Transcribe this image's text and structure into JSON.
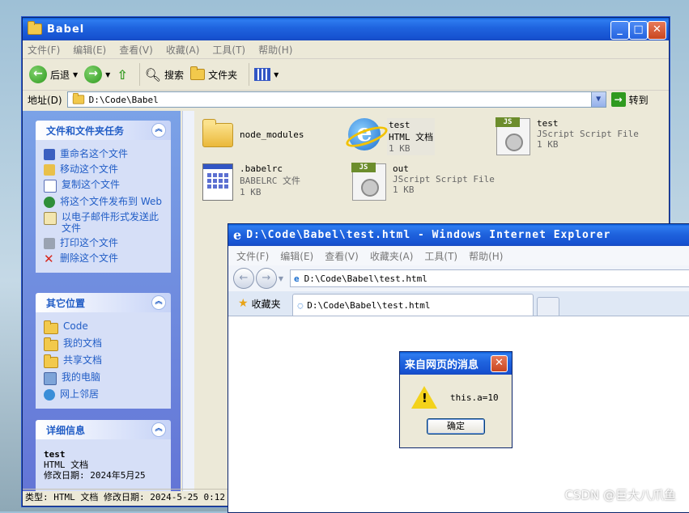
{
  "explorer": {
    "title": "Babel",
    "menu": [
      "文件(F)",
      "编辑(E)",
      "查看(V)",
      "收藏(A)",
      "工具(T)",
      "帮助(H)"
    ],
    "toolbar": {
      "back": "后退",
      "search": "搜索",
      "folders": "文件夹"
    },
    "address_label": "地址(D)",
    "address_value": "D:\\Code\\Babel",
    "go": "转到",
    "tasks_panel": {
      "title": "文件和文件夹任务",
      "items": [
        "重命名这个文件",
        "移动这个文件",
        "复制这个文件",
        "将这个文件发布到 Web",
        "以电子邮件形式发送此文件",
        "打印这个文件",
        "删除这个文件"
      ]
    },
    "places_panel": {
      "title": "其它位置",
      "items": [
        "Code",
        "我的文档",
        "共享文档",
        "我的电脑",
        "网上邻居"
      ]
    },
    "details_panel": {
      "title": "详细信息",
      "name": "test",
      "type": "HTML 文档",
      "modified": "修改日期: 2024年5月25"
    },
    "files": [
      {
        "name": "node_modules",
        "type": "",
        "size": ""
      },
      {
        "name": "test",
        "type": "HTML 文档",
        "size": "1 KB"
      },
      {
        "name": "test",
        "type": "JScript Script File",
        "size": "1 KB"
      },
      {
        "name": ".babelrc",
        "type": "BABELRC 文件",
        "size": "1 KB"
      },
      {
        "name": "out",
        "type": "JScript Script File",
        "size": "1 KB"
      }
    ],
    "status": "类型: HTML 文档 修改日期: 2024-5-25 0:12"
  },
  "ie": {
    "title": "D:\\Code\\Babel\\test.html - Windows Internet Explorer",
    "menu": [
      "文件(F)",
      "编辑(E)",
      "查看(V)",
      "收藏夹(A)",
      "工具(T)",
      "帮助(H)"
    ],
    "address": "D:\\Code\\Babel\\test.html",
    "favorites": "收藏夹",
    "tab_title": "D:\\Code\\Babel\\test.html"
  },
  "dialog": {
    "title": "来自网页的消息",
    "message": "this.a=10",
    "ok": "确定"
  },
  "watermark": "CSDN @巨大八爪鱼"
}
